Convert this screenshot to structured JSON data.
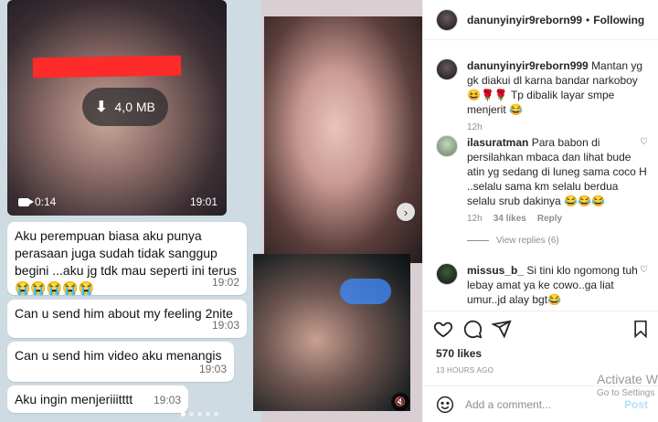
{
  "media": {
    "video": {
      "size": "4,0 MB",
      "duration": "0:14",
      "time": "19:01"
    },
    "chat": [
      {
        "text": "Aku perempuan biasa aku punya perasaan juga sudah tidak sanggup begini ...aku jg tdk mau seperti ini terus 😭😭😭😭😭",
        "time": "19:02"
      },
      {
        "text": "Can u send him about my feeling 2nite",
        "time": "19:03"
      },
      {
        "text": "Can u send him video aku menangis",
        "time": "19:03"
      },
      {
        "text": "Aku ingin menjeriiitttt",
        "time": "19:03"
      }
    ],
    "next_icon": "chevron-right-icon",
    "mute_icon": "speaker-muted-icon"
  },
  "post": {
    "header": {
      "username": "danunyinyir9reborn99",
      "separator": "•",
      "follow": "Following"
    },
    "caption": {
      "username": "danunyinyir9reborn999",
      "text": "Mantan yg gk diakui dl karna bandar narkoboy 😆🌹🌹 Tp dibalik layar smpe menjerit 😂",
      "age": "12h"
    },
    "comments": [
      {
        "username": "ilasuratman",
        "text": "Para babon di persilahkan mbaca dan lihat bude atin yg sedang di luneg sama coco H ..selalu sama km selalu berdua selalu srub dakinya 😂😂😂",
        "age": "12h",
        "likes": "34 likes",
        "reply": "Reply"
      },
      {
        "username": "missus_b_",
        "text": "Si tini klo ngomong tuh lebay amat ya ke cowo..ga liat umur..jd alay bgt😂"
      }
    ],
    "view_replies": "View replies (6)",
    "likes": "570 likes",
    "posted": "13 HOURS AGO",
    "add_comment": {
      "placeholder": "Add a comment...",
      "post": "Post"
    }
  },
  "watermark": {
    "line1": "Activate Windows",
    "line2": "Go to Settings"
  }
}
